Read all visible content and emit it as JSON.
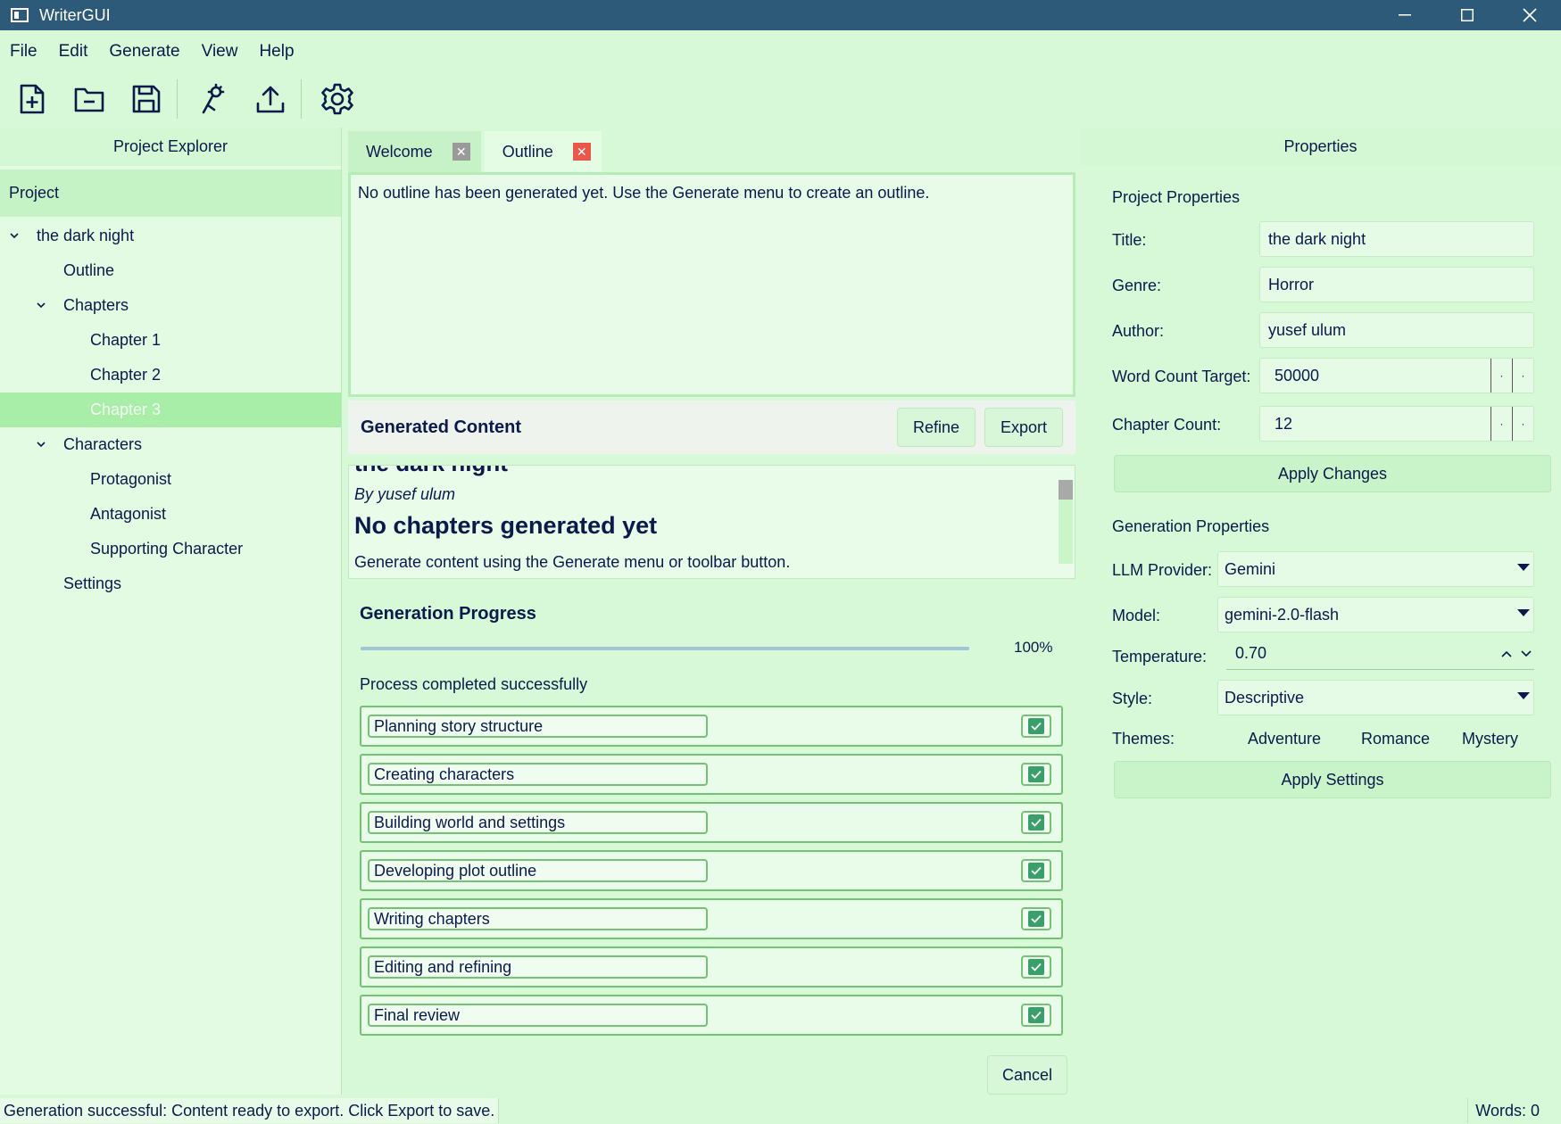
{
  "window": {
    "title": "WriterGUI"
  },
  "menu": [
    "File",
    "Edit",
    "Generate",
    "View",
    "Help"
  ],
  "toolbar": {
    "icons": [
      "new-file-icon",
      "open-folder-icon",
      "save-icon",
      "magic-wand-icon",
      "upload-icon",
      "gear-icon"
    ]
  },
  "explorer": {
    "header": "Project Explorer",
    "tree_header": "Project",
    "project": "the dark night",
    "outline": "Outline",
    "chapters": "Chapters",
    "chapter_items": [
      "Chapter 1",
      "Chapter 2",
      "Chapter 3"
    ],
    "characters": "Characters",
    "character_items": [
      "Protagonist",
      "Antagonist",
      "Supporting Character"
    ],
    "settings": "Settings"
  },
  "tabs": [
    {
      "label": "Welcome"
    },
    {
      "label": "Outline"
    }
  ],
  "outline_text": "No outline has been generated yet. Use the Generate menu to create an outline.",
  "generated": {
    "header": "Generated Content",
    "refine": "Refine",
    "export": "Export",
    "cut_title": "the dark night",
    "author": "By yusef ulum",
    "heading": "No chapters generated yet",
    "paragraph": "Generate content using the Generate menu or toolbar button."
  },
  "progress": {
    "title": "Generation Progress",
    "percent_value": 100,
    "percent_text": "100%",
    "status": "Process completed successfully",
    "steps": [
      "Planning story structure",
      "Creating characters",
      "Building world and settings",
      "Developing plot outline",
      "Writing chapters",
      "Editing and refining",
      "Final review"
    ],
    "cancel": "Cancel"
  },
  "properties": {
    "header": "Properties",
    "project_group": "Project Properties",
    "title_label": "Title:",
    "title_value": "the dark night",
    "genre_label": "Genre:",
    "genre_value": "Horror",
    "author_label": "Author:",
    "author_value": "yusef ulum",
    "wc_label": "Word Count Target:",
    "wc_value": "50000",
    "cc_label": "Chapter Count:",
    "cc_value": "12",
    "apply_changes": "Apply Changes",
    "gen_group": "Generation Properties",
    "llm_label": "LLM Provider:",
    "llm_value": "Gemini",
    "model_label": "Model:",
    "model_value": "gemini-2.0-flash",
    "temp_label": "Temperature:",
    "temp_value": "0.70",
    "style_label": "Style:",
    "style_value": "Descriptive",
    "themes_label": "Themes:",
    "themes": [
      "Adventure",
      "Romance",
      "Mystery"
    ],
    "apply_settings": "Apply Settings"
  },
  "statusbar": {
    "message": "Generation successful: Content ready to export. Click Export to save.",
    "words": "Words: 0"
  },
  "colors": {
    "titlebar": "#2e5a79",
    "background": "#d7f9d7",
    "selection": "#a8eea8",
    "close_active": "#e9574b",
    "close_inactive": "#9a9a9a",
    "check": "#3aa06b"
  }
}
